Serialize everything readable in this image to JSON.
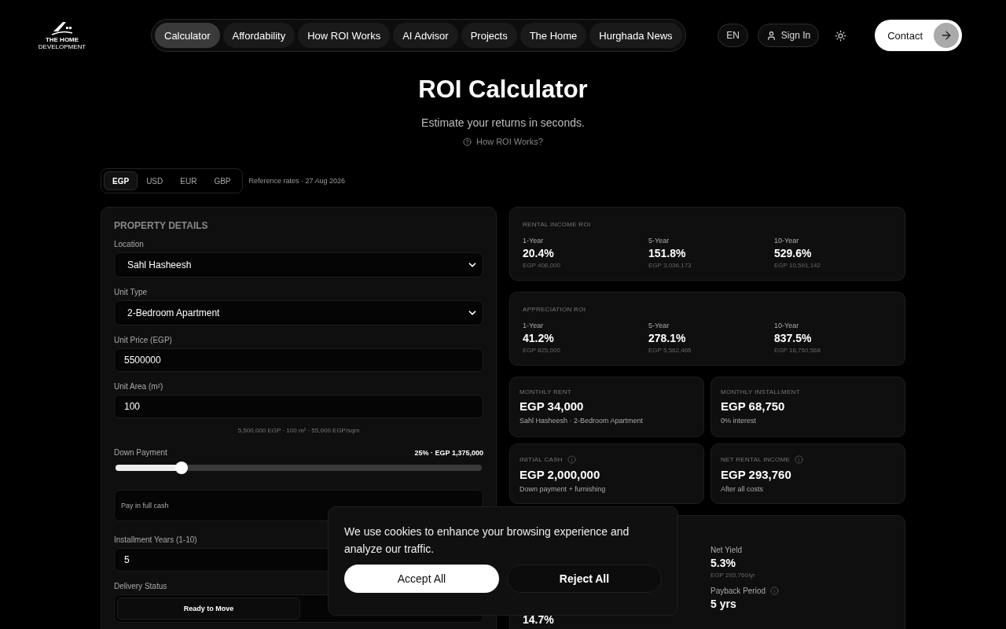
{
  "nav": {
    "logo": {
      "line1": "THE HOME",
      "line2": "DEVELOPMENT"
    },
    "links": [
      {
        "label": "Calculator",
        "selected": true
      },
      {
        "label": "Affordability",
        "selected": false
      },
      {
        "label": "How ROI Works",
        "selected": false
      },
      {
        "label": "AI Advisor",
        "selected": false
      },
      {
        "label": "Projects",
        "selected": false
      },
      {
        "label": "The Home",
        "selected": false
      },
      {
        "label": "Hurghada News",
        "selected": false
      }
    ],
    "language": "EN",
    "sign_in": "Sign In",
    "contact": "Contact"
  },
  "hero": {
    "title": "ROI Calculator",
    "subtitle": "Estimate your returns in seconds.",
    "help_link": "How ROI Works?"
  },
  "currency": {
    "options": [
      {
        "label": "EGP",
        "selected": true
      },
      {
        "label": "USD",
        "selected": false
      },
      {
        "label": "EUR",
        "selected": false
      },
      {
        "label": "GBP",
        "selected": false
      }
    ],
    "note": "Reference rates · 27 Aug 2026"
  },
  "property": {
    "heading": "PROPERTY DETAILS",
    "fields": [
      {
        "kind": "select",
        "label": "Location",
        "value": "Sahl Hasheesh"
      },
      {
        "kind": "select",
        "label": "Unit Type",
        "value": "2-Bedroom Apartment"
      },
      {
        "kind": "input",
        "label": "Unit Price (EGP)",
        "value": "5500000"
      },
      {
        "kind": "input",
        "label": "Unit Area (m²)",
        "value": "100"
      },
      {
        "kind": "note",
        "text": "5,500,000 EGP · 100 m² · 55,000 EGP/sqm"
      },
      {
        "kind": "slider",
        "label": "Down Payment",
        "reading": "25% · EGP 1,375,000",
        "level": 0.18
      },
      {
        "kind": "toggle",
        "label": "Pay in full cash"
      },
      {
        "kind": "input",
        "label": "Installment Years (1-10)",
        "value": "5"
      },
      {
        "kind": "segmented",
        "label": "Delivery Status",
        "options": [
          {
            "label": "Ready to Move",
            "selected": true
          }
        ]
      }
    ]
  },
  "roi_cards": [
    {
      "title": "RENTAL INCOME ROI",
      "periods": [
        {
          "label": "1-Year",
          "value": "20.4%",
          "amount": "EGP 408,000"
        },
        {
          "label": "5-Year",
          "value": "151.8%",
          "amount": "EGP 3,036,173"
        },
        {
          "label": "10-Year",
          "value": "529.6%",
          "amount": "EGP 10,591,142"
        }
      ]
    },
    {
      "title": "APPRECIATION ROI",
      "periods": [
        {
          "label": "1-Year",
          "value": "41.2%",
          "amount": "EGP 825,000"
        },
        {
          "label": "5-Year",
          "value": "278.1%",
          "amount": "EGP 5,562,465"
        },
        {
          "label": "10-Year",
          "value": "837.5%",
          "amount": "EGP 16,750,568"
        }
      ]
    }
  ],
  "stat_cards": [
    {
      "title": "MONTHLY RENT",
      "info": false,
      "value": "EGP 34,000",
      "caption": "Sahl Hasheesh · 2-Bedroom Apartment"
    },
    {
      "title": "MONTHLY INSTALLMENT",
      "info": false,
      "value": "EGP 68,750",
      "caption": "0% interest"
    },
    {
      "title": "INITIAL CASH",
      "info": true,
      "value": "EGP 2,000,000",
      "caption": "Down payment + furnishing"
    },
    {
      "title": "NET RENTAL INCOME",
      "info": true,
      "value": "EGP 293,760",
      "caption": "After all costs"
    }
  ],
  "metrics": {
    "left": [
      {
        "value": "14.7%"
      }
    ],
    "right": [
      {
        "label": "Net Yield",
        "info": false,
        "value": "5.3%",
        "caption": "EGP 293,760/yr"
      },
      {
        "label": "Payback Period",
        "info": true,
        "value": "5 yrs"
      }
    ]
  },
  "cookie": {
    "text": "We use cookies to enhance your browsing experience and analyze our traffic.",
    "accept": "Accept All",
    "reject": "Reject All"
  }
}
